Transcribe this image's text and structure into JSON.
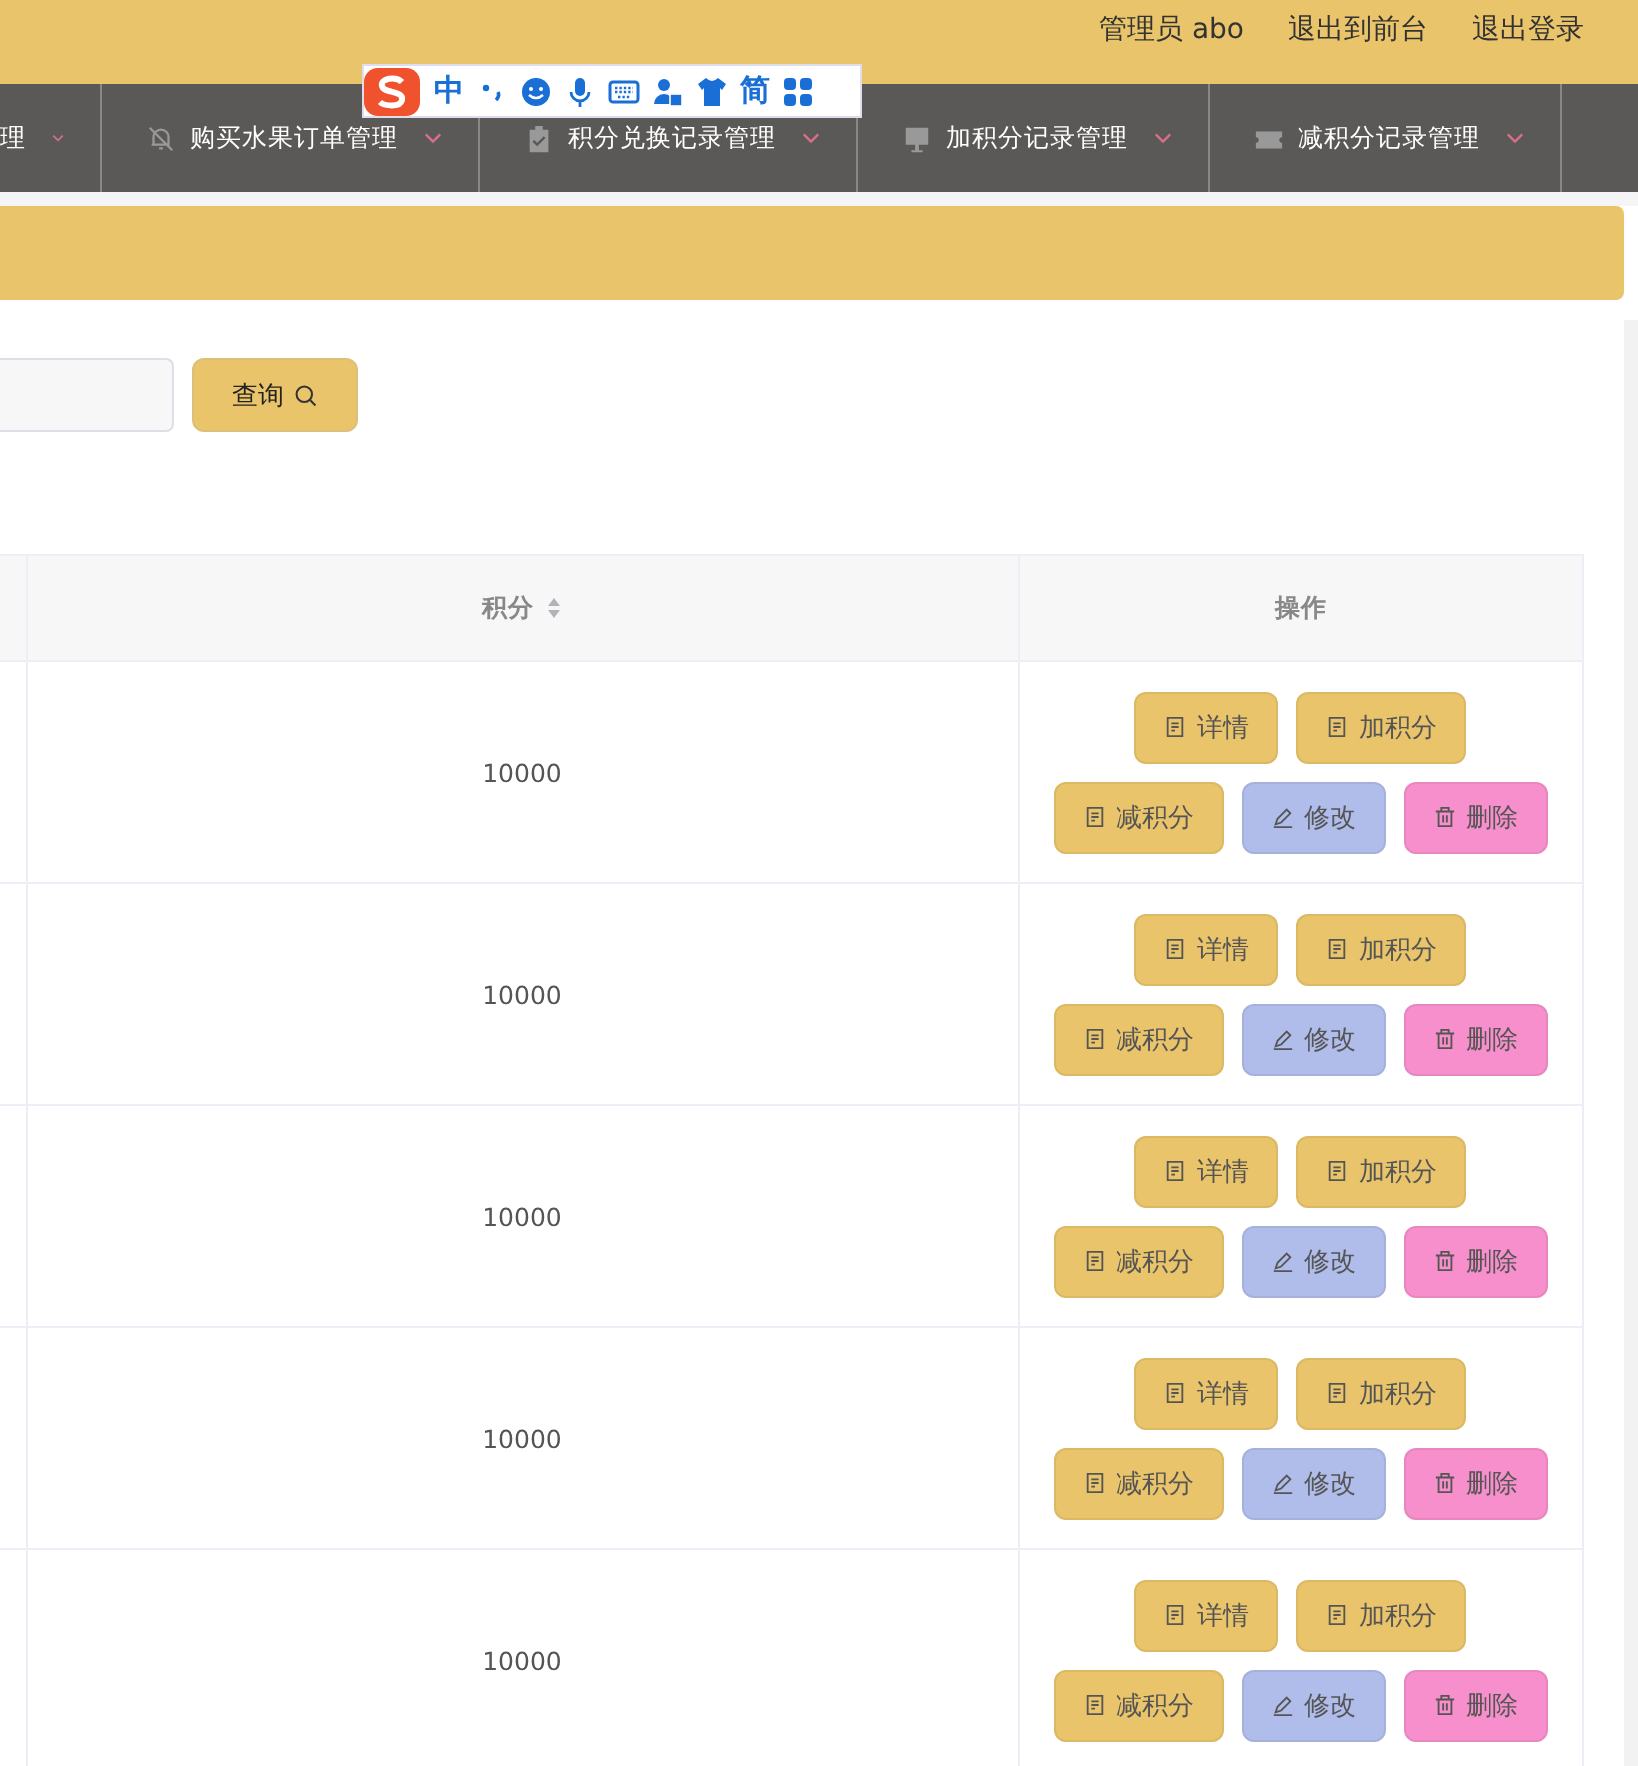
{
  "top_bar": {
    "user": "管理员 abo",
    "links": [
      "退出到前台",
      "退出登录"
    ]
  },
  "nav": [
    {
      "label": "理"
    },
    {
      "label": "购买水果订单管理"
    },
    {
      "label": "积分兑换记录管理"
    },
    {
      "label": "加积分记录管理"
    },
    {
      "label": "减积分记录管理"
    }
  ],
  "ime_toolbar": {
    "mode": "中",
    "script": "简"
  },
  "search": {
    "button": "查询"
  },
  "table": {
    "columns": [
      "积分",
      "操作"
    ],
    "rows": [
      {
        "score": "10000",
        "actions": [
          {
            "kind": "doc",
            "label": "详情"
          },
          {
            "kind": "doc",
            "label": "加积分"
          },
          {
            "kind": "doc",
            "label": "减积分"
          },
          {
            "kind": "edit",
            "label": "修改"
          },
          {
            "kind": "delete",
            "label": "删除"
          }
        ]
      },
      {
        "score": "10000",
        "actions": [
          {
            "kind": "doc",
            "label": "详情"
          },
          {
            "kind": "doc",
            "label": "加积分"
          },
          {
            "kind": "doc",
            "label": "减积分"
          },
          {
            "kind": "edit",
            "label": "修改"
          },
          {
            "kind": "delete",
            "label": "删除"
          }
        ]
      },
      {
        "score": "10000",
        "actions": [
          {
            "kind": "doc",
            "label": "详情"
          },
          {
            "kind": "doc",
            "label": "加积分"
          },
          {
            "kind": "doc",
            "label": "减积分"
          },
          {
            "kind": "edit",
            "label": "修改"
          },
          {
            "kind": "delete",
            "label": "删除"
          }
        ]
      },
      {
        "score": "10000",
        "actions": [
          {
            "kind": "doc",
            "label": "详情"
          },
          {
            "kind": "doc",
            "label": "加积分"
          },
          {
            "kind": "doc",
            "label": "减积分"
          },
          {
            "kind": "edit",
            "label": "修改"
          },
          {
            "kind": "delete",
            "label": "删除"
          }
        ]
      },
      {
        "score": "10000",
        "actions": [
          {
            "kind": "doc",
            "label": "详情"
          },
          {
            "kind": "doc",
            "label": "加积分"
          },
          {
            "kind": "doc",
            "label": "减积分"
          },
          {
            "kind": "edit",
            "label": "修改"
          },
          {
            "kind": "delete",
            "label": "删除"
          }
        ]
      }
    ]
  }
}
